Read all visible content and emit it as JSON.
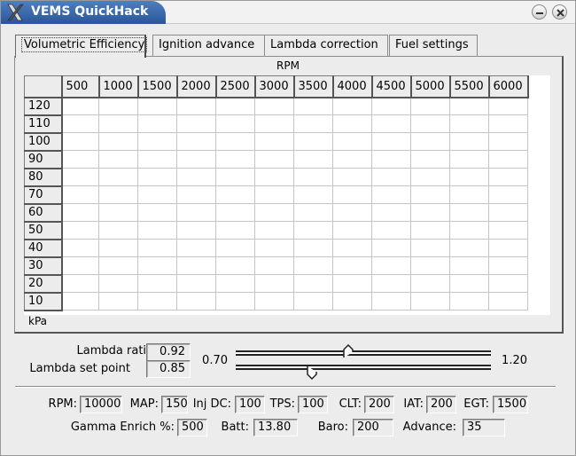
{
  "window": {
    "title": "VEMS QuickHack"
  },
  "tabs": [
    {
      "label": "Volumetric Efficiency"
    },
    {
      "label": "Ignition advance"
    },
    {
      "label": "Lambda correction"
    },
    {
      "label": "Fuel settings"
    }
  ],
  "table": {
    "x_axis_label": "RPM",
    "y_axis_label": "kPa",
    "columns": [
      "500",
      "1000",
      "1500",
      "2000",
      "2500",
      "3000",
      "3500",
      "4000",
      "4500",
      "5000",
      "5500",
      "6000"
    ],
    "rows": [
      "120",
      "110",
      "100",
      "90",
      "80",
      "70",
      "60",
      "50",
      "40",
      "30",
      "20",
      "10"
    ]
  },
  "lambda": {
    "ratio_label": "Lambda ratio",
    "ratio_value": "0.92",
    "setpoint_label": "Lambda set point",
    "setpoint_value": "0.85",
    "range_min": "0.70",
    "range_max": "1.20",
    "ratio_fraction": 0.44,
    "setpoint_fraction": 0.3
  },
  "status": {
    "rpm_label": "RPM:",
    "rpm_value": "10000",
    "map_label": "MAP:",
    "map_value": "150",
    "injdc_label": "Inj DC:",
    "injdc_value": "100",
    "tps_label": "TPS:",
    "tps_value": "100",
    "clt_label": "CLT:",
    "clt_value": "200",
    "iat_label": "IAT:",
    "iat_value": "200",
    "egt_label": "EGT:",
    "egt_value": "1500",
    "gamma_label": "Gamma Enrich %:",
    "gamma_value": "500",
    "batt_label": "Batt:",
    "batt_value": "13.80",
    "baro_label": "Baro:",
    "baro_value": "200",
    "advance_label": "Advance:",
    "advance_value": "35"
  }
}
